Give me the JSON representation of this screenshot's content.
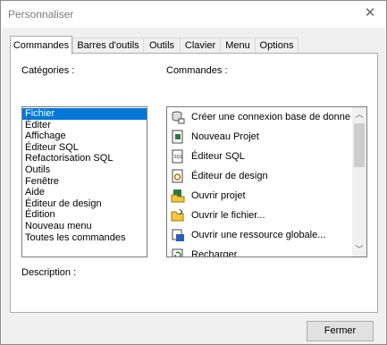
{
  "window": {
    "title": "Personnaliser",
    "close_icon": "close-icon"
  },
  "tabs": [
    {
      "label": "Commandes",
      "active": true
    },
    {
      "label": "Barres d'outils",
      "active": false
    },
    {
      "label": "Outils",
      "active": false
    },
    {
      "label": "Clavier",
      "active": false
    },
    {
      "label": "Menu",
      "active": false
    },
    {
      "label": "Options",
      "active": false
    }
  ],
  "categories": {
    "label": "Catégories :",
    "selected": "Fichier",
    "items": [
      "Fichier",
      "Éditer",
      "Affichage",
      "Éditeur SQL",
      "Refactorisation SQL",
      "Outils",
      "Fenêtre",
      "Aide",
      "Éditeur de design",
      "Édition",
      "Nouveau menu",
      "Toutes les commandes"
    ]
  },
  "commands": {
    "label": "Commandes :",
    "items": [
      {
        "label": "Créer une connexion base de donne",
        "icon": "database-connection-icon"
      },
      {
        "label": "Nouveau Projet",
        "icon": "new-project-icon"
      },
      {
        "label": "Éditeur SQL",
        "icon": "sql-editor-icon"
      },
      {
        "label": "Éditeur de design",
        "icon": "design-editor-icon"
      },
      {
        "label": "Ouvrir projet",
        "icon": "open-project-icon"
      },
      {
        "label": "Ouvrir le fichier...",
        "icon": "open-folder-icon"
      },
      {
        "label": "Ouvrir une ressource globale...",
        "icon": "global-resource-icon"
      },
      {
        "label": "Recharger",
        "icon": "reload-icon"
      }
    ]
  },
  "description": {
    "label": "Description :"
  },
  "footer": {
    "close_button": "Fermer"
  },
  "colors": {
    "selection": "#0078d7",
    "dialog_bg": "#f0f0f0"
  }
}
